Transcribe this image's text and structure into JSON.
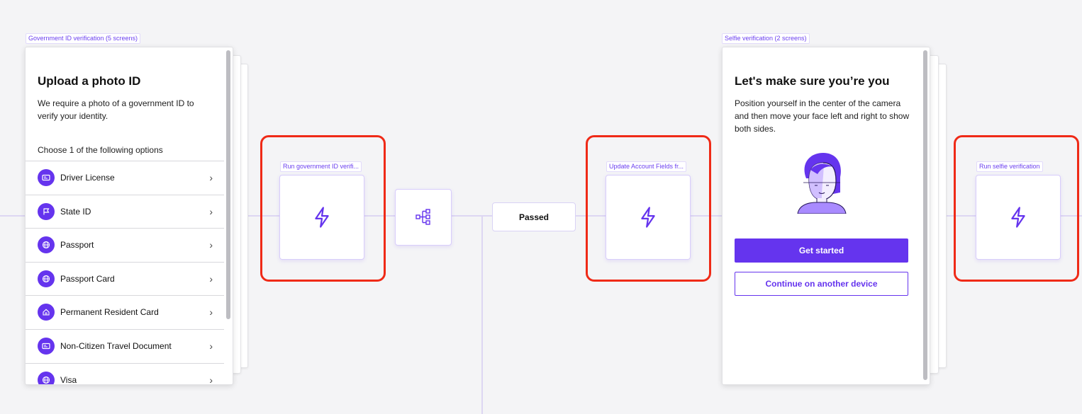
{
  "colors": {
    "accent": "#6534ee",
    "highlight": "#ef2a17",
    "canvas": "#f4f4f6"
  },
  "gov_id": {
    "tag": "Government ID verification (5 screens)",
    "title": "Upload a photo ID",
    "description": "We require a photo of a government ID to verify your identity.",
    "choose_label": "Choose 1 of the following options",
    "options": [
      {
        "label": "Driver License",
        "icon": "id-card-icon"
      },
      {
        "label": "State ID",
        "icon": "flag-icon"
      },
      {
        "label": "Passport",
        "icon": "globe-icon"
      },
      {
        "label": "Passport Card",
        "icon": "globe-icon"
      },
      {
        "label": "Permanent Resident Card",
        "icon": "home-icon"
      },
      {
        "label": "Non-Citizen Travel Document",
        "icon": "id-card-icon"
      },
      {
        "label": "Visa",
        "icon": "globe-icon"
      }
    ]
  },
  "action_nodes": {
    "run_gov_id": "Run government ID verifi...",
    "update_account": "Update Account Fields fr...",
    "run_selfie": "Run selfie verification"
  },
  "branch": {
    "passed_label": "Passed",
    "icon": "branch-icon"
  },
  "selfie": {
    "tag": "Selfie verification (2 screens)",
    "title": "Let's make sure you’re you",
    "description": "Position yourself in the center of the camera and then move your face left and right to show both sides.",
    "primary_button": "Get started",
    "secondary_button": "Continue on another device"
  }
}
